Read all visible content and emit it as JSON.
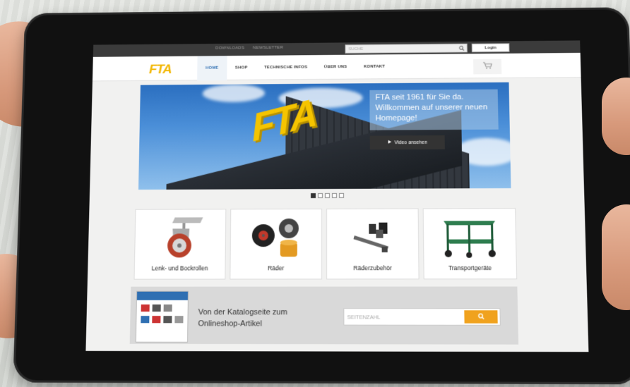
{
  "topbar": {
    "links": [
      "DOWNLOADS",
      "NEWSLETTER"
    ],
    "search_placeholder": "SUCHE",
    "login_label": "Login"
  },
  "nav": {
    "logo": "FTA",
    "items": [
      "HOME",
      "SHOP",
      "TECHNISCHE INFOS",
      "ÜBER UNS",
      "KONTAKT"
    ],
    "active": "HOME"
  },
  "hero": {
    "sign": "FTA",
    "headline": "FTA seit 1961 für Sie da. Willkommen auf unserer neuen Homepage!",
    "video_label": "Video ansehen",
    "slides": 5,
    "active_slide": 1
  },
  "categories": [
    {
      "label": "Lenk- und Bockrollen"
    },
    {
      "label": "Räder"
    },
    {
      "label": "Räderzubehör"
    },
    {
      "label": "Transportgeräte"
    }
  ],
  "catalog": {
    "text": "Von der Katalogseite zum Onlineshop-Artikel",
    "line1": "Von der Katalogseite zum",
    "line2": "Onlineshop-Artikel",
    "input_placeholder": "SEITENZAHL"
  },
  "colors": {
    "brand_blue": "#2f6fb2",
    "brand_yellow": "#f2b705",
    "accent_orange": "#f0a21e"
  }
}
